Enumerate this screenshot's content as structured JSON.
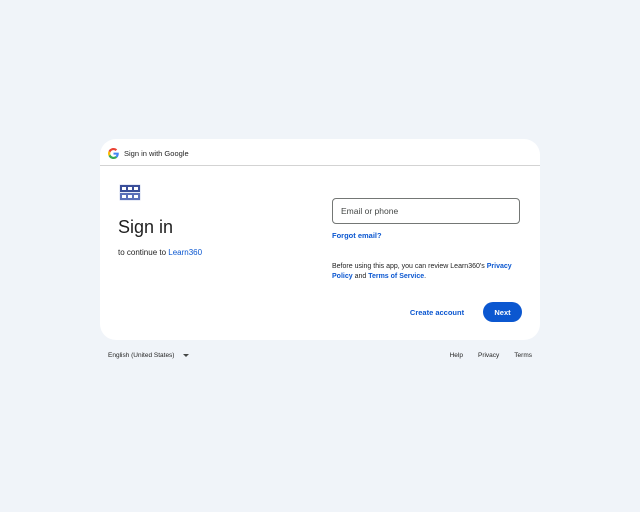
{
  "header": {
    "title": "Sign in with Google"
  },
  "main": {
    "heading": "Sign in",
    "subtitle_prefix": "to continue to ",
    "app_name": "Learn360",
    "email_placeholder": "Email or phone",
    "forgot_label": "Forgot email?",
    "notice_prefix": "Before using this app, you can review Learn360’s ",
    "privacy_policy_label": "Privacy Policy",
    "notice_and": " and ",
    "terms_of_service_label": "Terms of Service",
    "notice_suffix": ".",
    "create_account_label": "Create account",
    "next_label": "Next"
  },
  "footer": {
    "language": "English (United States)",
    "links": [
      "Help",
      "Privacy",
      "Terms"
    ]
  },
  "colors": {
    "background": "#f0f4f9",
    "accent": "#0b57d0",
    "text": "#1f1f1f"
  }
}
